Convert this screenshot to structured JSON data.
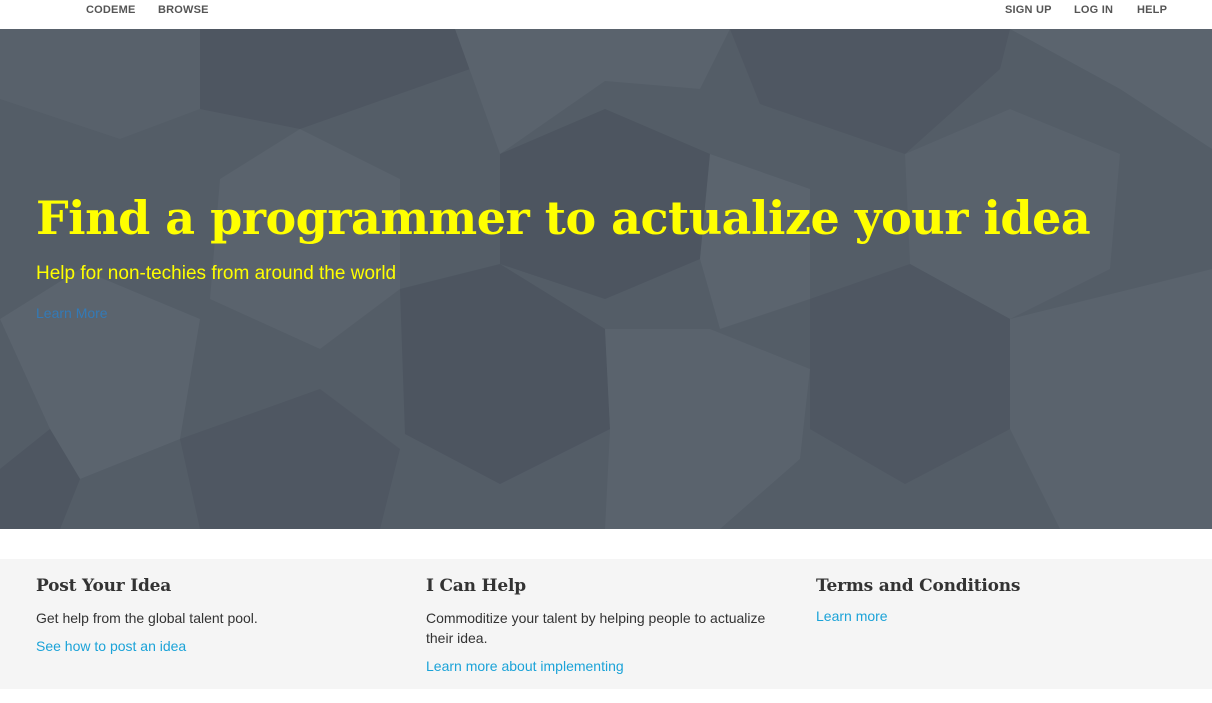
{
  "nav": {
    "brand": "CODEME",
    "browse": "BROWSE",
    "sign_up": "SIGN UP",
    "log_in": "LOG IN",
    "help": "HELP"
  },
  "hero": {
    "title": "Find a programmer to actualize your idea",
    "subtitle": "Help for non-techies from around the world",
    "link": "Learn More"
  },
  "features": [
    {
      "title": "Post Your Idea",
      "text": "Get help from the global talent pool.",
      "link": "See how to post an idea"
    },
    {
      "title": "I Can Help",
      "text": "Commoditize your talent by helping people to actualize their idea.",
      "link": "Learn more about implementing"
    },
    {
      "title": "Terms and Conditions",
      "text": "",
      "link": "Learn more"
    }
  ],
  "colors": {
    "hero_bg": "#545d67",
    "hero_text": "#ffff00",
    "link": "#1ba3d8",
    "features_bg": "#f5f5f5"
  }
}
